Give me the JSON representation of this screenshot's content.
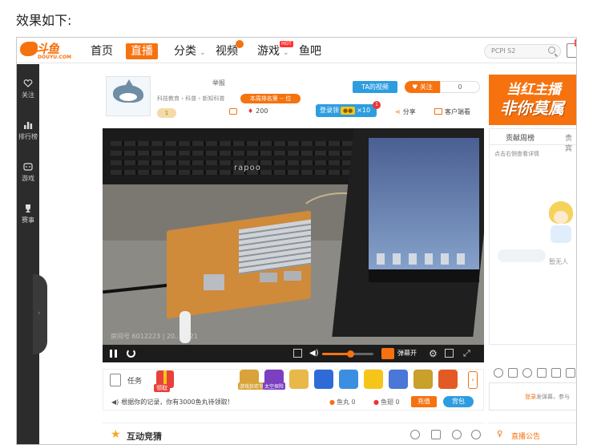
{
  "caption": "效果如下:",
  "logo": {
    "name": "斗鱼",
    "sub": "DOUYU.COM"
  },
  "nav": {
    "home": "首页",
    "live": "直播",
    "category": "分类",
    "video": "视频",
    "games": "游戏",
    "fishbar": "鱼吧",
    "hot_badge": "HOT"
  },
  "search": {
    "placeholder": "PCPI S2"
  },
  "sidebar": {
    "items": [
      {
        "label": "关注",
        "icon": "heart-icon"
      },
      {
        "label": "排行榜",
        "icon": "bar-chart-icon"
      },
      {
        "label": "游戏",
        "icon": "gamepad-icon"
      },
      {
        "label": "赛事",
        "icon": "trophy-icon"
      }
    ],
    "collapse_glyph": "›"
  },
  "anchor": {
    "report": "举报",
    "breadcrumb": "科技教育 › 科普 › 新知科普",
    "rank": "本周排名第 -- 位",
    "level": "1",
    "hot": "200",
    "ta_video": "TA的视频",
    "follow": "关注",
    "follow_count": "0",
    "login_gift": "登录领",
    "login_gift_times": "×10",
    "login_gift_badge": "1",
    "share": "分享",
    "client": "客户端看"
  },
  "video": {
    "keyboard_brand": "rapoo",
    "room_overlay": "房间号 6012223 | 20… …21"
  },
  "controls": {
    "danmu_label": "弹幕开",
    "volume_level": 0.55
  },
  "taskbar": {
    "task_label": "任务",
    "gift_label": "领取",
    "record_text": "根据你的记录，你有3000鱼丸待领取！",
    "fishball": "鱼丸 0",
    "fishfin": "鱼翅 0",
    "recharge": "充值",
    "backpack": "背包",
    "more": "›",
    "games": [
      {
        "label": "游戏狂欢节",
        "color": "#d9a33a"
      },
      {
        "label": "太空探险",
        "color": "#7b3fc1"
      },
      {
        "label": "",
        "color": "#e8b84a"
      },
      {
        "label": "",
        "color": "#2e6bd6"
      },
      {
        "label": "",
        "color": "#3a8fe0"
      },
      {
        "label": "",
        "color": "#f5c518"
      },
      {
        "label": "",
        "color": "#4a77d8"
      },
      {
        "label": "",
        "color": "#c8a02a"
      },
      {
        "label": "",
        "color": "#e35a25"
      }
    ]
  },
  "quiz": {
    "title": "互动竞猜"
  },
  "right": {
    "ad_line1": "当红主播",
    "ad_line2": "非你莫属",
    "tab_weekly": "贡献周榜",
    "tab_noble": "贵宾",
    "hint": "点击右侧查看详情",
    "empty": "暂无人",
    "login_link": "登录",
    "login_hint": "发弹幕，参与",
    "notice": "直播公告"
  },
  "colors": {
    "accent": "#f6720f",
    "blue": "#2e9de0",
    "sidebar": "#2c2c2c"
  }
}
